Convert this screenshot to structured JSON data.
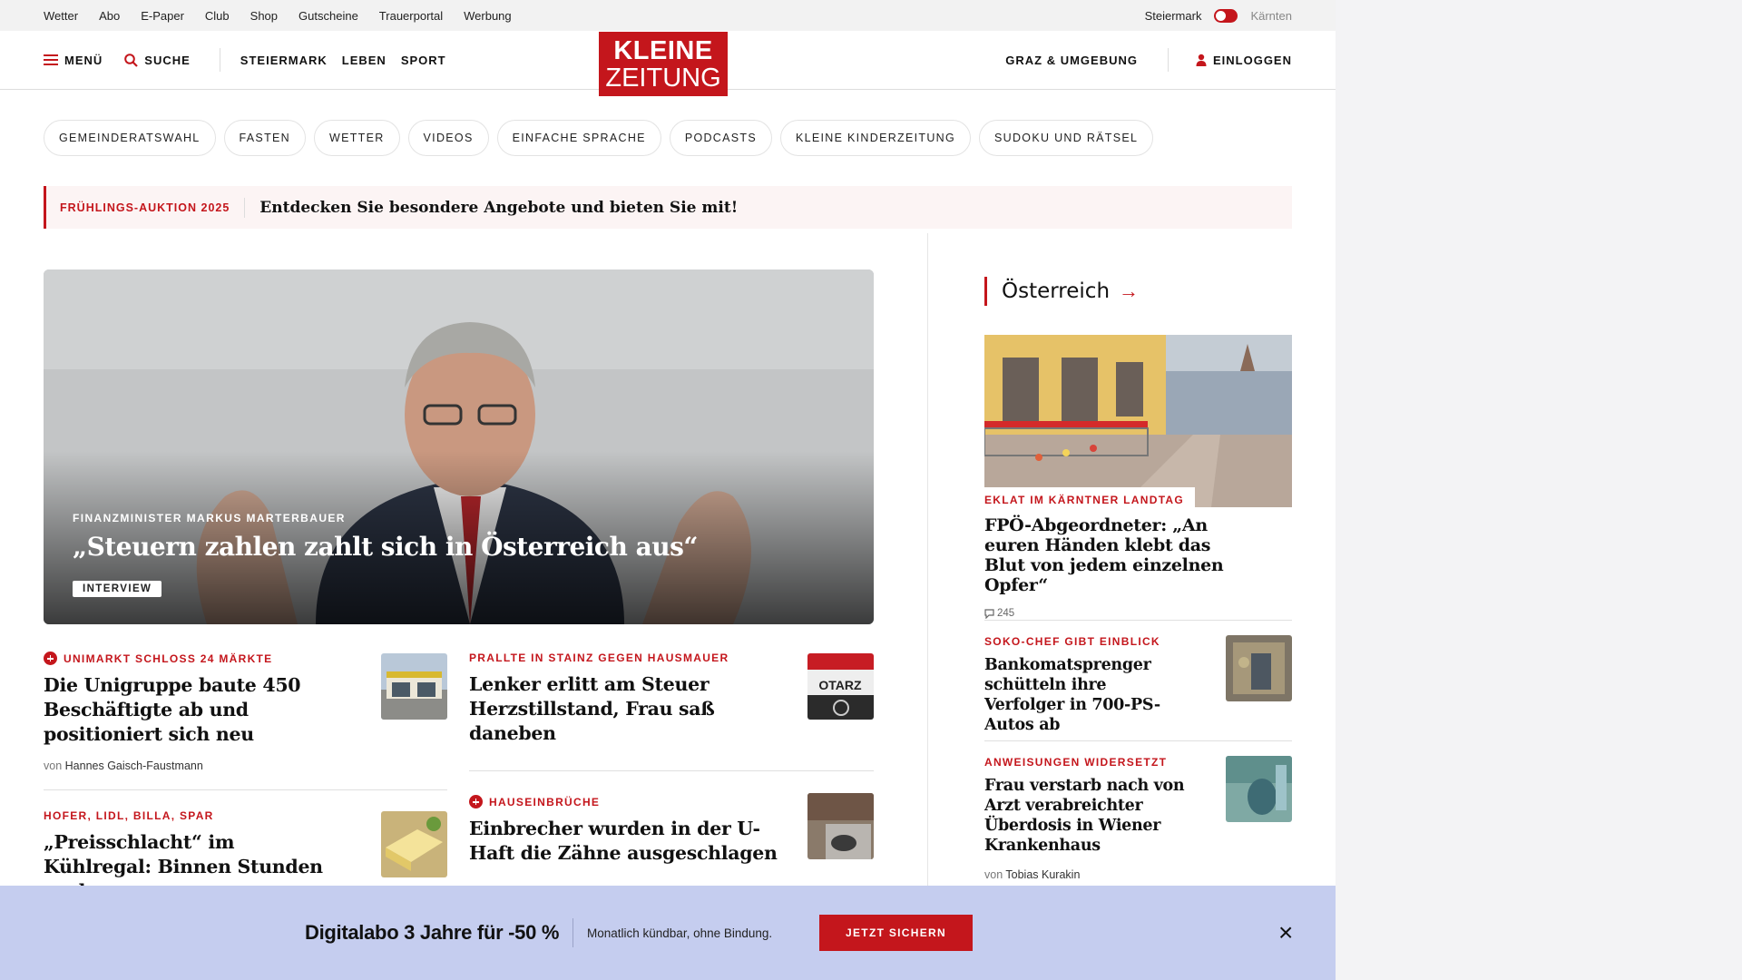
{
  "utility_bar": {
    "links": [
      "Wetter",
      "Abo",
      "E-Paper",
      "Club",
      "Shop",
      "Gutscheine",
      "Trauerportal",
      "Werbung"
    ],
    "region_active": "Steiermark",
    "region_inactive": "Kärnten"
  },
  "header": {
    "menu_label": "MENÜ",
    "search_label": "SUCHE",
    "nav": [
      "STEIERMARK",
      "LEBEN",
      "SPORT"
    ],
    "logo_line1": "KLEINE",
    "logo_line2": "ZEITUNG",
    "region_link": "GRAZ & UMGEBUNG",
    "login_label": "EINLOGGEN"
  },
  "tags": [
    "GEMEINDERATSWAHL",
    "FASTEN",
    "WETTER",
    "VIDEOS",
    "EINFACHE SPRACHE",
    "PODCASTS",
    "KLEINE KINDERZEITUNG",
    "SUDOKU UND RÄTSEL"
  ],
  "promo": {
    "label": "FRÜHLINGS-AUKTION 2025",
    "text": "Entdecken Sie besondere Angebote und bieten Sie mit!"
  },
  "hero": {
    "kicker": "FINANZMINISTER MARKUS MARTERBAUER",
    "title": "„Steuern zahlen zahlt sich in Österreich aus“",
    "badge": "INTERVIEW"
  },
  "articles": [
    {
      "kicker": "UNIMARKT SCHLOSS 24 MÄRKTE",
      "premium": true,
      "headline": "Die Unigruppe baute 450 Beschäftigte ab und positioniert sich neu",
      "byline_prefix": "von",
      "author": "Hannes Gaisch-Faustmann"
    },
    {
      "kicker": "PRALLTE IN STAINZ GEGEN HAUSMAUER",
      "premium": false,
      "headline": "Lenker erlitt am Steuer Herzstillstand, Frau saß daneben",
      "thumb_text": "OTARZ"
    },
    {
      "kicker": "HOFER, LIDL, BILLA, SPAR",
      "premium": false,
      "headline": "„Preisschlacht“ im Kühlregal: Binnen Stunden senken"
    },
    {
      "kicker": "HAUSEINBRÜCHE",
      "premium": true,
      "headline": "Einbrecher wurden in der U-Haft die Zähne ausgeschlagen"
    }
  ],
  "sidebar": {
    "section_title": "Österreich",
    "featured": {
      "kicker": "EKLAT IM KÄRNTNER LANDTAG",
      "headline": "FPÖ-Abgeordneter: „An euren Händen klebt das Blut von jedem einzelnen Opfer“",
      "comments": "245"
    },
    "items": [
      {
        "kicker": "SOKO-CHEF GIBT EINBLICK",
        "headline": "Bankomatsprenger schütteln ihre Verfolger in 700-PS-Autos ab"
      },
      {
        "kicker": "ANWEISUNGEN WIDERSETZT",
        "headline": "Frau verstarb nach von Arzt verabreichter Überdosis in Wiener Krankenhaus",
        "byline_prefix": "von",
        "author": "Tobias Kurakin"
      }
    ]
  },
  "banner": {
    "title": "Digitalabo 3 Jahre für -50 %",
    "subtitle": "Monatlich kündbar, ohne Bindung.",
    "cta": "JETZT SICHERN",
    "close": "×"
  },
  "colors": {
    "brand_red": "#c4161c",
    "banner_bg": "#c5cdef",
    "promo_bg": "#fcf4f4"
  }
}
